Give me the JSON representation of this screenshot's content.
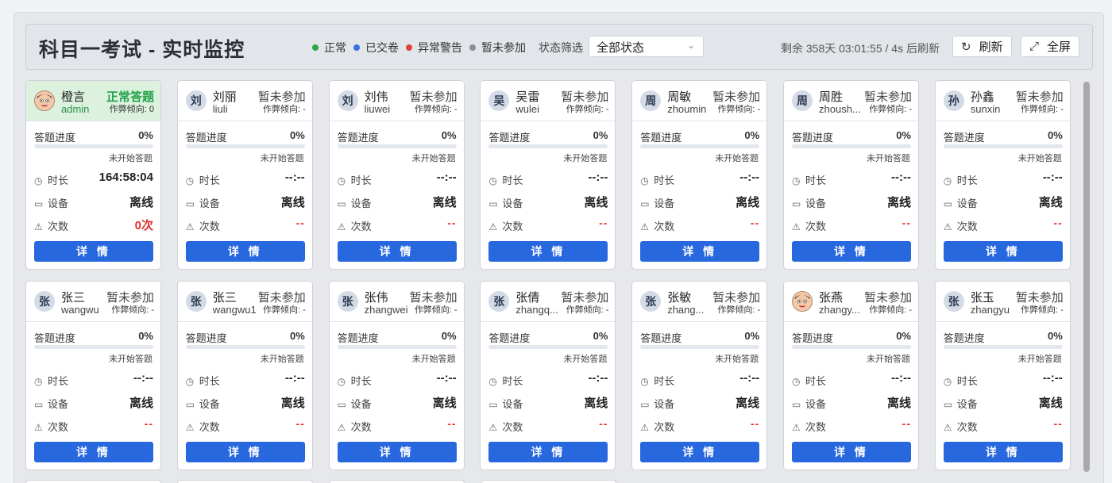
{
  "header": {
    "title": "科目一考试 - 实时监控",
    "legend": [
      {
        "label": "正常",
        "color": "#2aa845"
      },
      {
        "label": "已交卷",
        "color": "#3b6fe0"
      },
      {
        "label": "异常警告",
        "color": "#e0413a"
      },
      {
        "label": "暂未参加",
        "color": "#8a8f96"
      }
    ],
    "filter_label": "状态筛选",
    "filter_value": "全部状态",
    "timer_text": "剩余 358天 03:01:55 / 4s 后刷新",
    "refresh_label": "刷新",
    "fullscreen_label": "全屏"
  },
  "labels": {
    "progress": "答题进度",
    "duration": "时长",
    "device": "设备",
    "count": "次数",
    "detail": "详 情"
  },
  "students": [
    {
      "avatar": "",
      "name": "橙言",
      "username": "admin",
      "status": "正常答题",
      "trend": "作弊倾向: 0",
      "progress": "0%",
      "progress_note": "未开始答题",
      "duration": "164:58:04",
      "device": "离线",
      "count": "0次",
      "active": true
    },
    {
      "avatar": "刘",
      "name": "刘丽",
      "username": "liuli",
      "status": "暂未参加",
      "trend": "作弊倾向: -",
      "progress": "0%",
      "progress_note": "未开始答题",
      "duration": "--:--",
      "device": "离线",
      "count": "--"
    },
    {
      "avatar": "刘",
      "name": "刘伟",
      "username": "liuwei",
      "status": "暂未参加",
      "trend": "作弊倾向: -",
      "progress": "0%",
      "progress_note": "未开始答题",
      "duration": "--:--",
      "device": "离线",
      "count": "--"
    },
    {
      "avatar": "吴",
      "name": "吴雷",
      "username": "wulei",
      "status": "暂未参加",
      "trend": "作弊倾向: -",
      "progress": "0%",
      "progress_note": "未开始答题",
      "duration": "--:--",
      "device": "离线",
      "count": "--"
    },
    {
      "avatar": "周",
      "name": "周敏",
      "username": "zhoumin",
      "status": "暂未参加",
      "trend": "作弊倾向: -",
      "progress": "0%",
      "progress_note": "未开始答题",
      "duration": "--:--",
      "device": "离线",
      "count": "--"
    },
    {
      "avatar": "周",
      "name": "周胜",
      "username": "zhoush...",
      "status": "暂未参加",
      "trend": "作弊倾向: -",
      "progress": "0%",
      "progress_note": "未开始答题",
      "duration": "--:--",
      "device": "离线",
      "count": "--"
    },
    {
      "avatar": "孙",
      "name": "孙鑫",
      "username": "sunxin",
      "status": "暂未参加",
      "trend": "作弊倾向: -",
      "progress": "0%",
      "progress_note": "未开始答题",
      "duration": "--:--",
      "device": "离线",
      "count": "--"
    },
    {
      "avatar": "张",
      "name": "张三",
      "username": "wangwu",
      "status": "暂未参加",
      "trend": "作弊倾向: -",
      "progress": "0%",
      "progress_note": "未开始答题",
      "duration": "--:--",
      "device": "离线",
      "count": "--"
    },
    {
      "avatar": "张",
      "name": "张三",
      "username": "wangwu1",
      "status": "暂未参加",
      "trend": "作弊倾向: -",
      "progress": "0%",
      "progress_note": "未开始答题",
      "duration": "--:--",
      "device": "离线",
      "count": "--"
    },
    {
      "avatar": "张",
      "name": "张伟",
      "username": "zhangwei",
      "status": "暂未参加",
      "trend": "作弊倾向: -",
      "progress": "0%",
      "progress_note": "未开始答题",
      "duration": "--:--",
      "device": "离线",
      "count": "--"
    },
    {
      "avatar": "张",
      "name": "张倩",
      "username": "zhangq...",
      "status": "暂未参加",
      "trend": "作弊倾向: -",
      "progress": "0%",
      "progress_note": "未开始答题",
      "duration": "--:--",
      "device": "离线",
      "count": "--"
    },
    {
      "avatar": "张",
      "name": "张敏",
      "username": "zhang...",
      "status": "暂未参加",
      "trend": "作弊倾向: -",
      "progress": "0%",
      "progress_note": "未开始答题",
      "duration": "--:--",
      "device": "离线",
      "count": "--"
    },
    {
      "avatar": "",
      "name": "张燕",
      "username": "zhangy...",
      "status": "暂未参加",
      "trend": "作弊倾向: -",
      "progress": "0%",
      "progress_note": "未开始答题",
      "duration": "--:--",
      "device": "离线",
      "count": "--"
    },
    {
      "avatar": "张",
      "name": "张玉",
      "username": "zhangyu",
      "status": "暂未参加",
      "trend": "作弊倾向: -",
      "progress": "0%",
      "progress_note": "未开始答题",
      "duration": "--:--",
      "device": "离线",
      "count": "--"
    }
  ]
}
